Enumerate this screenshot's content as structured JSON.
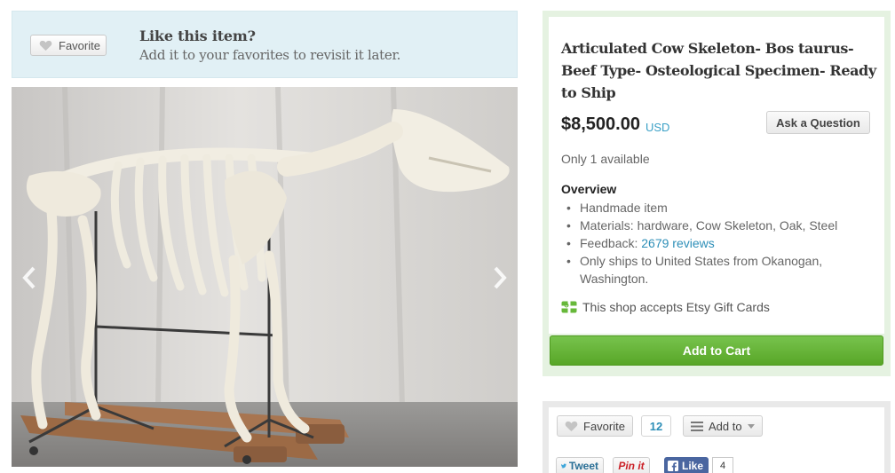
{
  "favorite_banner": {
    "button_label": "Favorite",
    "title": "Like this item?",
    "subtitle": "Add it to your favorites to revisit it later."
  },
  "listing": {
    "title": "Articulated Cow Skeleton- Bos taurus- Beef Type- Osteological Specimen- Ready to Ship",
    "price": "$8,500.00",
    "currency": "USD",
    "ask_button": "Ask a Question",
    "availability": "Only 1 available",
    "overview_heading": "Overview",
    "overview_items": {
      "handmade": "Handmade item",
      "materials": "Materials: hardware, Cow Skeleton, Oak, Steel",
      "feedback_label": "Feedback:",
      "feedback_link": "2679 reviews",
      "ships": "Only ships to United States from Okanogan, Washington."
    },
    "gift_cards": "This shop accepts Etsy Gift Cards",
    "add_to_cart": "Add to Cart"
  },
  "social": {
    "favorite_label": "Favorite",
    "favorite_count": "12",
    "add_to_label": "Add to",
    "tweet_label": "Tweet",
    "pinit_label": "Pin it",
    "like_label": "Like",
    "like_count": "4"
  },
  "colors": {
    "banner_bg": "#e1f0f5",
    "panel_bg": "#e5f2e1",
    "cart_green": "#58a627",
    "link_blue": "#2e8fb8",
    "facebook_blue": "#4a66a0"
  },
  "icons": [
    "heart-icon",
    "chevron-left-icon",
    "chevron-right-icon",
    "gift-card-icon",
    "list-icon",
    "dropdown-arrow-icon",
    "twitter-icon",
    "facebook-icon"
  ]
}
